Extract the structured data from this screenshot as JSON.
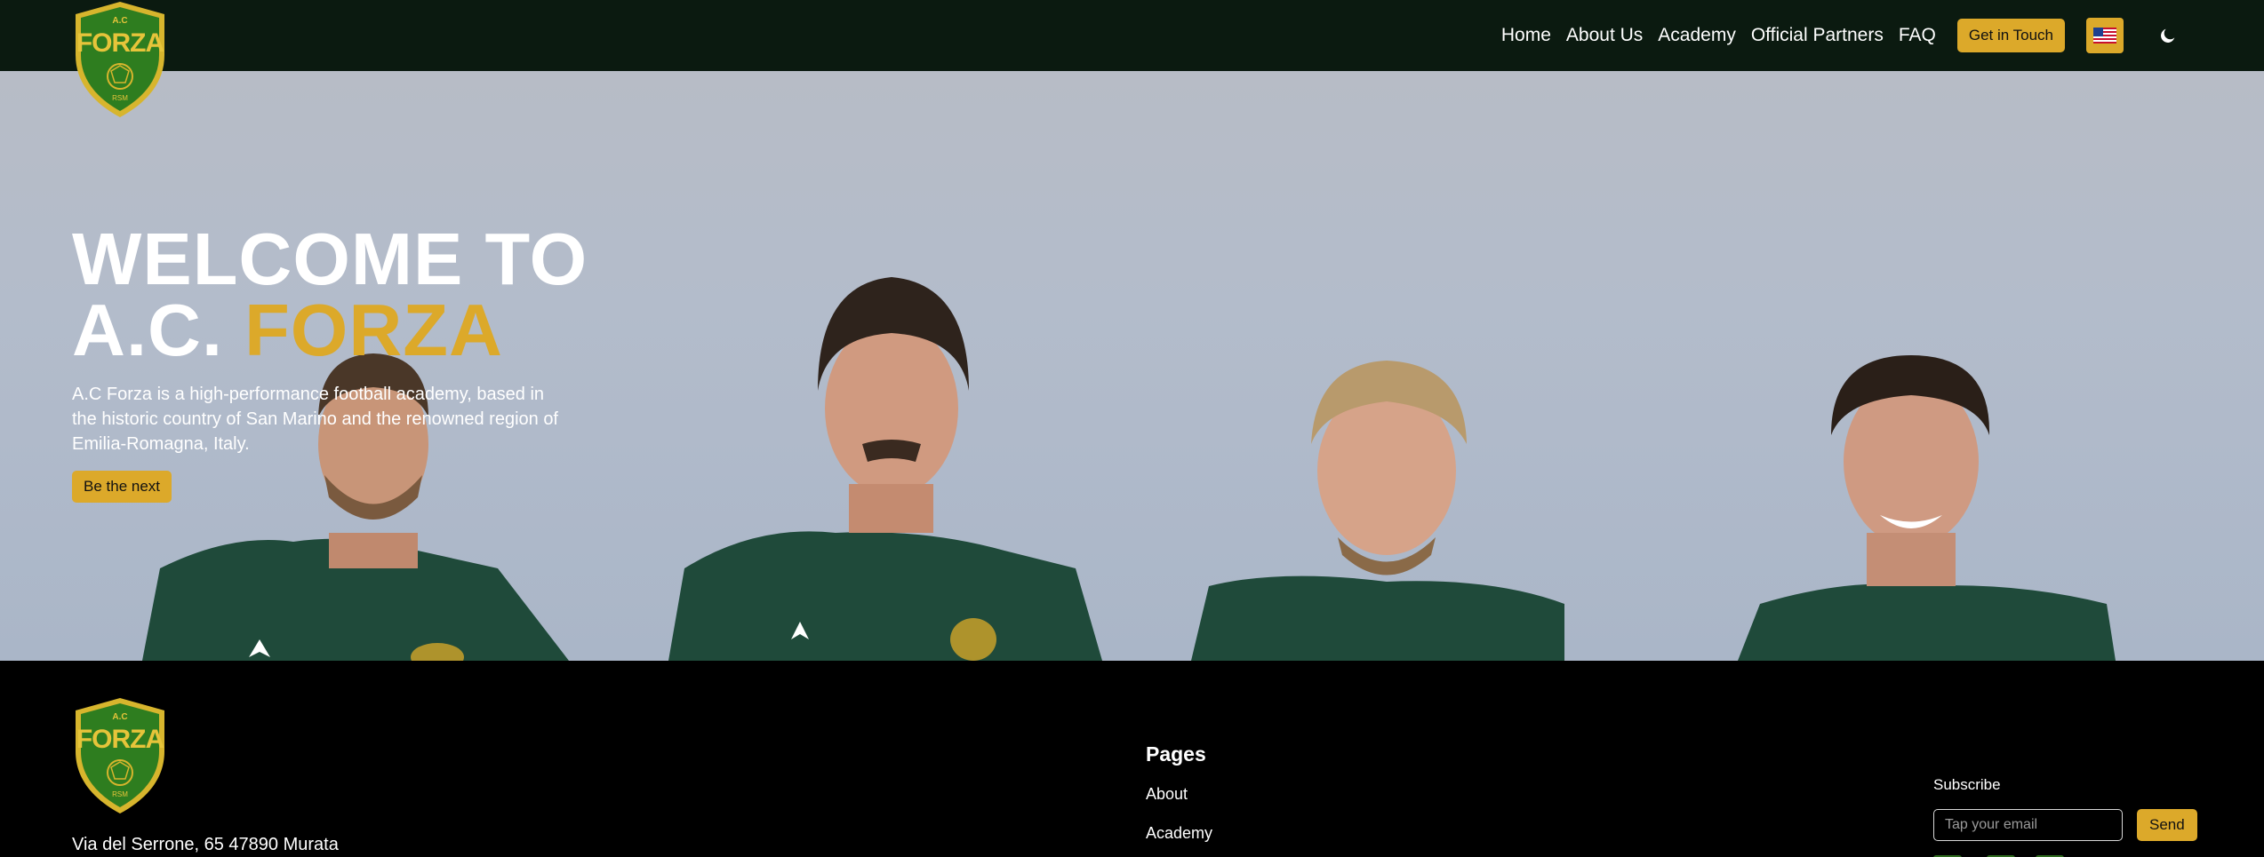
{
  "brand": {
    "logo_top": "A.C",
    "logo_main": "FORZA",
    "logo_bottom": "RSM",
    "colors": {
      "navy_green": "#0b1a10",
      "gold": "#dca92a",
      "shield_green": "#2e7d1f"
    }
  },
  "nav": {
    "items": [
      {
        "label": "Home"
      },
      {
        "label": "About Us"
      },
      {
        "label": "Academy"
      },
      {
        "label": "Official Partners"
      },
      {
        "label": "FAQ"
      }
    ],
    "cta_label": "Get in Touch",
    "language_icon": "us-flag-icon",
    "theme_icon": "moon-icon"
  },
  "hero": {
    "title_line1": "WELCOME TO",
    "title_line2_prefix": "A.C.",
    "title_line2_accent": "FORZA",
    "description": "A.C Forza is a high-performance football academy, based in the historic country of San Marino and the renowned region of Emilia-Romagna, Italy.",
    "button_label": "Be the next"
  },
  "footer": {
    "address": "Via del Serrone, 65 47890 Murata",
    "pages_heading": "Pages",
    "pages_links": [
      {
        "label": "About"
      },
      {
        "label": "Academy"
      }
    ],
    "subscribe_label": "Subscribe",
    "email_placeholder": "Tap your email",
    "send_label": "Send"
  }
}
